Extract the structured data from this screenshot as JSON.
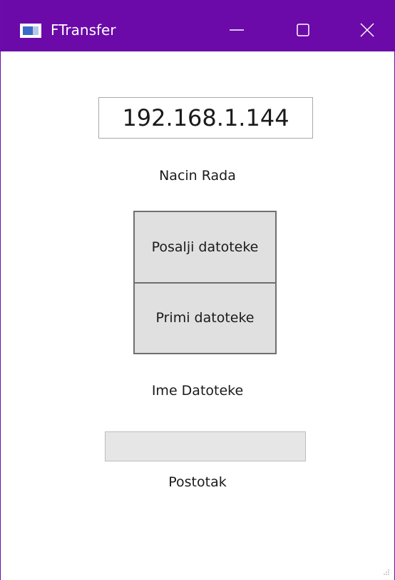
{
  "window": {
    "title": "FTransfer",
    "titlebar_color": "#6b0aa8",
    "controls": {
      "minimize_icon": "minimize-icon",
      "maximize_icon": "maximize-icon",
      "close_icon": "close-icon"
    }
  },
  "main": {
    "ip_address_value": "192.168.1.144",
    "mode_label": "Nacin Rada",
    "send_button_label": "Posalji datoteke",
    "receive_button_label": "Primi datoteke",
    "file_name_label": "Ime Datoteke",
    "progress_value": 0,
    "percent_label": "Postotak"
  }
}
